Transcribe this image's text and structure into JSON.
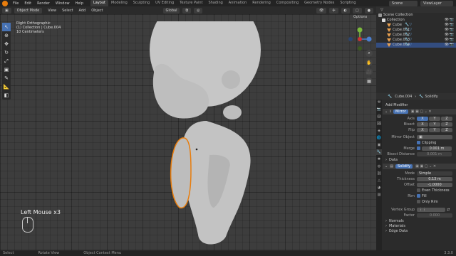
{
  "topbar": {
    "menu": [
      "File",
      "Edit",
      "Render",
      "Window",
      "Help"
    ],
    "tabs": [
      "Layout",
      "Modeling",
      "Sculpting",
      "UV Editing",
      "Texture Paint",
      "Shading",
      "Animation",
      "Rendering",
      "Compositing",
      "Geometry Nodes",
      "Scripting"
    ],
    "active_tab": "Layout",
    "scene": "Scene",
    "view_layer": "ViewLayer"
  },
  "header": {
    "mode": "Object Mode",
    "menus": [
      "View",
      "Select",
      "Add",
      "Object"
    ],
    "orientation": "Global",
    "options": "Options"
  },
  "viewport": {
    "view_name": "Right Orthographic",
    "collection": "(1) Collection | Cube.004",
    "scale": "10 Centimeters",
    "operator": "Left Mouse x3"
  },
  "outliner": {
    "title": "Scene Collection",
    "items": [
      {
        "name": "Collection",
        "level": 1
      },
      {
        "name": "Cube",
        "level": 2
      },
      {
        "name": "Cube.001",
        "level": 2
      },
      {
        "name": "Cube.002",
        "level": 2
      },
      {
        "name": "Cube.003",
        "level": 2
      },
      {
        "name": "Cube.004",
        "level": 2,
        "selected": true
      }
    ]
  },
  "properties": {
    "object": "Cube.004",
    "modifier_label": "Solidify",
    "add_modifier": "Add Modifier",
    "mirror": {
      "name": "Mirror",
      "axis_label": "Axis",
      "bisect_label": "Bisect",
      "flip_label": "Flip",
      "axes": [
        "X",
        "Y",
        "Z"
      ],
      "mirror_object": "Mirror Object",
      "clipping": "Clipping",
      "merge_label": "Merge",
      "merge_value": "0.001 m",
      "bisect_distance": "Bisect Distance",
      "bisect_value": "0.001 m",
      "data": "Data"
    },
    "solidify": {
      "name": "Solidify",
      "mode_label": "Mode",
      "mode_value": "Simple",
      "thickness_label": "Thickness",
      "thickness_value": "0.13 m",
      "offset_label": "Offset",
      "offset_value": "-1.0000",
      "even": "Even Thickness",
      "rim_label": "Rim",
      "fill": "Fill",
      "only_rim": "Only Rim",
      "vgroup_label": "Vertex Group",
      "factor_label": "Factor",
      "factor_value": "0.000",
      "normals": "Normals",
      "materials": "Materials",
      "edge_data": "Edge Data"
    }
  },
  "status": {
    "select": "Select",
    "rotate": "Rotate View",
    "menu": "Object Context Menu",
    "version": "3.3.0"
  },
  "colors": {
    "accent": "#4772b3",
    "selection": "#e87d0d",
    "model": "#c8c8c8"
  }
}
